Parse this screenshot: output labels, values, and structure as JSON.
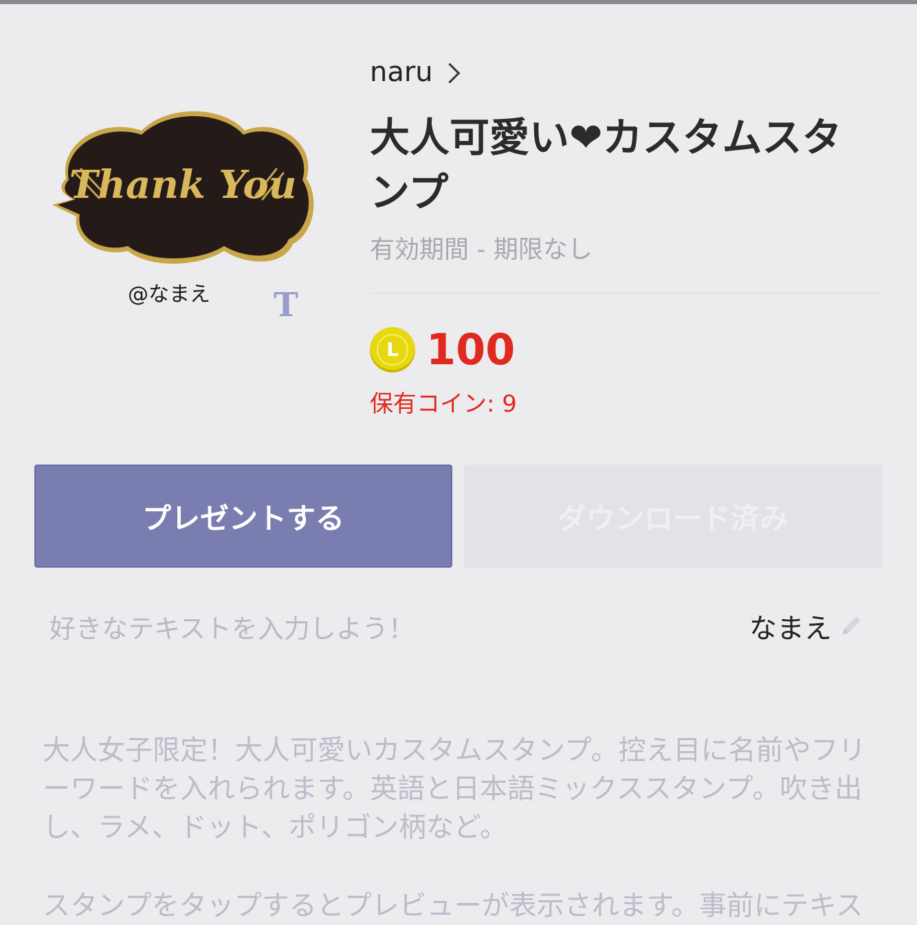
{
  "colors": {
    "background": "#ececee",
    "accent": "#7a7daf",
    "price_red": "#e0291f",
    "coin_yellow": "#e8d80f"
  },
  "sticker": {
    "main_text": "Thank You",
    "name_tag": "@なまえ",
    "badge_letter": "T",
    "icon": "custom-text-badge-icon"
  },
  "header": {
    "author": "naru",
    "title": "大人可愛い❤カスタムスタンプ",
    "validity": "有効期間 - 期限なし"
  },
  "price": {
    "coin_letter": "L",
    "amount": "100",
    "owned": "保有コイン: 9"
  },
  "buttons": {
    "present_label": "プレゼントする",
    "downloaded_label": "ダウンロード済み"
  },
  "custom_text": {
    "hint": "好きなテキストを入力しよう！",
    "value": "なまえ",
    "icon": "pencil-icon"
  },
  "description": {
    "paragraph1": "大人女子限定！大人可愛いカスタムスタンプ。控え目に名前やフリーワードを入れられます。英語と日本語ミックススタンプ。吹き出し、ラメ、ドット、ポリゴン柄など。",
    "paragraph2": "スタンプをタップするとプレビューが表示されます。事前にテキス"
  }
}
